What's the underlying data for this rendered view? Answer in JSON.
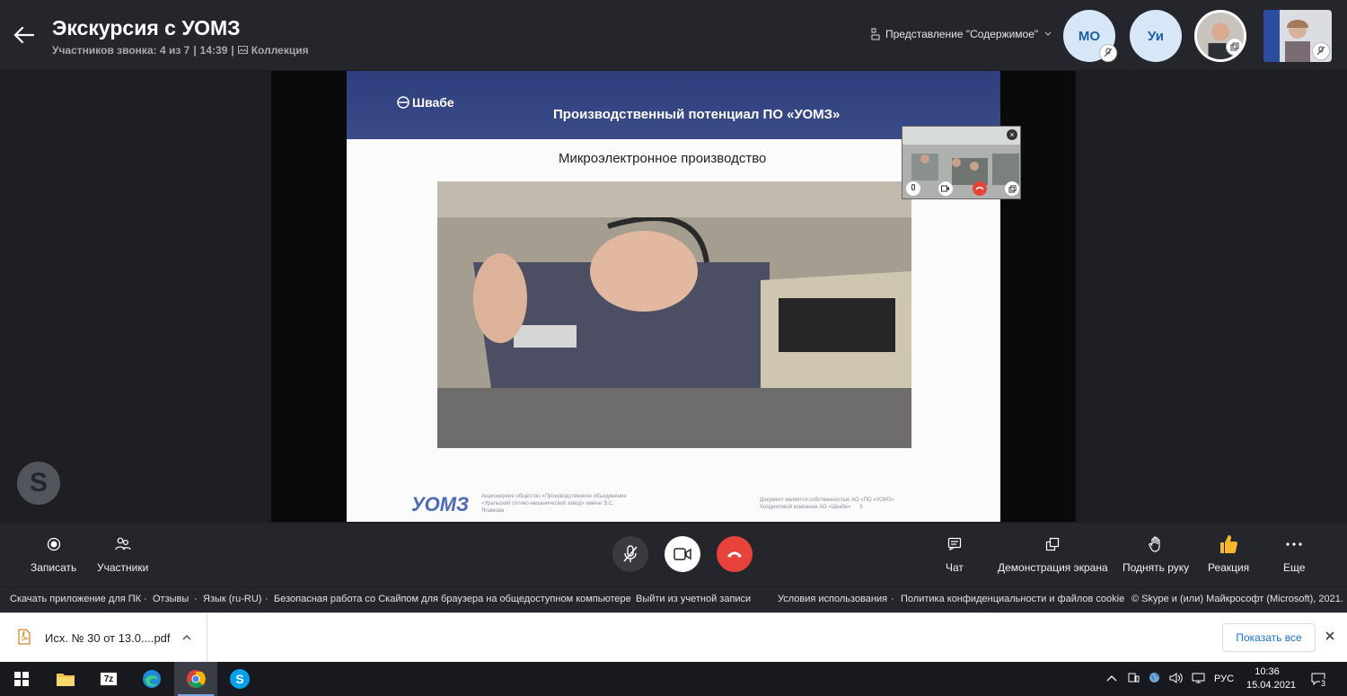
{
  "header": {
    "title": "Экскурсия с УОМЗ",
    "participants": "Участников звонка: 4 из 7",
    "duration": "14:39",
    "collection": "Коллекция",
    "view_mode": "Представление \"Содержимое\"",
    "avatars": [
      {
        "initials": "МО"
      },
      {
        "initials": "Уи"
      }
    ]
  },
  "slide": {
    "brand": "Швабе",
    "title": "Производственный потенциал ПО «УОМЗ»",
    "subtitle": "Микроэлектронное производство",
    "footer_logo": "УОМЗ",
    "footer_left": "Акционерное общество «Производственное объединение «Уральский оптико-механический завод» имени Э.С. Яламова",
    "footer_right": "Документ является собственностью АО «ПО «УОМЗ» Холдинговой компании АО «Швабе»",
    "page": "5"
  },
  "controls": {
    "record": "Записать",
    "participants": "Участники",
    "chat": "Чат",
    "screen_share": "Демонстрация экрана",
    "raise_hand": "Поднять руку",
    "reaction": "Реакция",
    "more": "Еще"
  },
  "footer_links": {
    "download_app": "Скачать приложение для ПК",
    "feedback": "Отзывы",
    "language": "Язык (ru-RU)",
    "safety": "Безопасная работа со Скайпом для браузера на общедоступном компьютере",
    "logout": "Выйти из учетной записи",
    "terms": "Условия использования",
    "privacy": "Политика конфиденциальности и файлов cookie",
    "copyright": "© Skype и (или) Майкрософт (Microsoft), 2021."
  },
  "download": {
    "file_name": "Исх. № 30 от 13.0....pdf",
    "show_all": "Показать все"
  },
  "taskbar": {
    "language": "РУС",
    "time": "10:36",
    "date": "15.04.2021",
    "notifications": "3",
    "app_7z": "7z"
  },
  "colors": {
    "accent_blue": "#1a73e8",
    "end_call_red": "#e8433a",
    "skype_blue": "#00a2ed",
    "reaction_yellow": "#f7b731"
  }
}
